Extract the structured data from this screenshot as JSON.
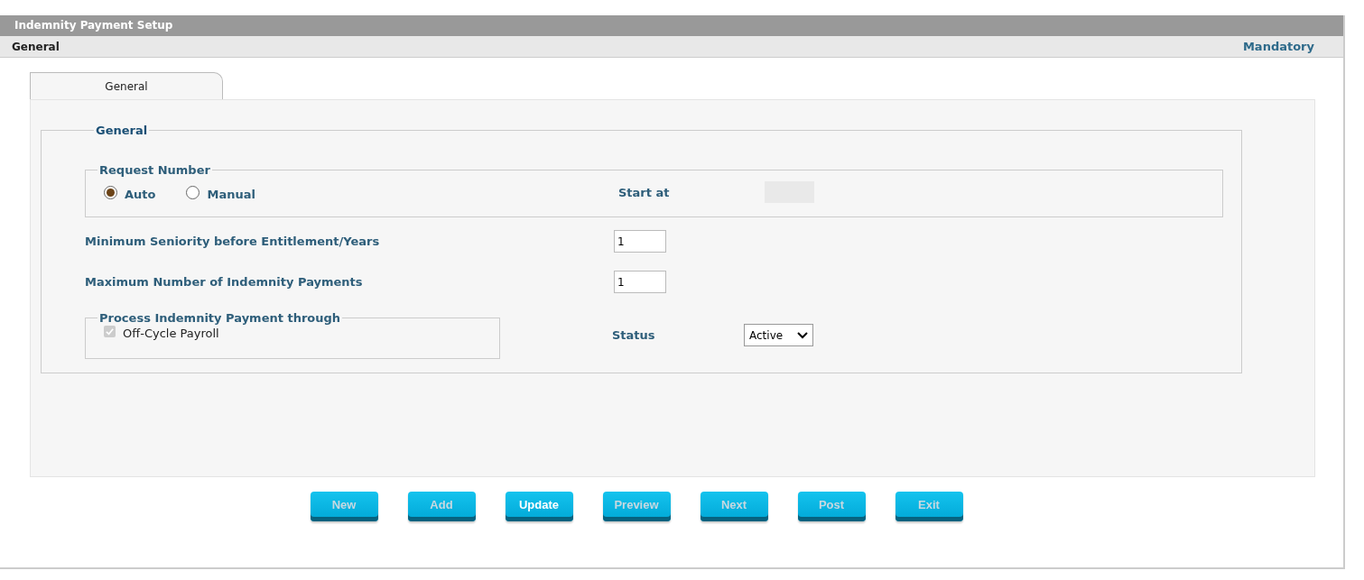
{
  "window": {
    "title": "Indemnity Payment Setup"
  },
  "header": {
    "section": "General",
    "mandatory": "Mandatory"
  },
  "tabs": [
    {
      "label": "General",
      "selected": true
    }
  ],
  "group": {
    "title": "General",
    "request_number": {
      "title": "Request Number",
      "options": [
        {
          "label": "Auto",
          "selected": true
        },
        {
          "label": "Manual",
          "selected": false
        }
      ],
      "start_at_label": "Start at"
    },
    "fields": [
      {
        "label": "Minimum Seniority before Entitlement/Years",
        "value": "1"
      },
      {
        "label": "Maximum Number of Indemnity Payments",
        "value": "1"
      }
    ],
    "process": {
      "title": "Process Indemnity Payment through",
      "checkbox": {
        "label": "Off-Cycle Payroll",
        "checked": true,
        "disabled": true
      }
    },
    "status": {
      "label": "Status",
      "value": "Active"
    }
  },
  "buttons": [
    {
      "label": "New",
      "disabled": true
    },
    {
      "label": "Add",
      "disabled": true
    },
    {
      "label": "Update",
      "disabled": false
    },
    {
      "label": "Preview",
      "disabled": true
    },
    {
      "label": "Next",
      "disabled": true
    },
    {
      "label": "Post",
      "disabled": true
    },
    {
      "label": "Exit",
      "disabled": true
    }
  ]
}
